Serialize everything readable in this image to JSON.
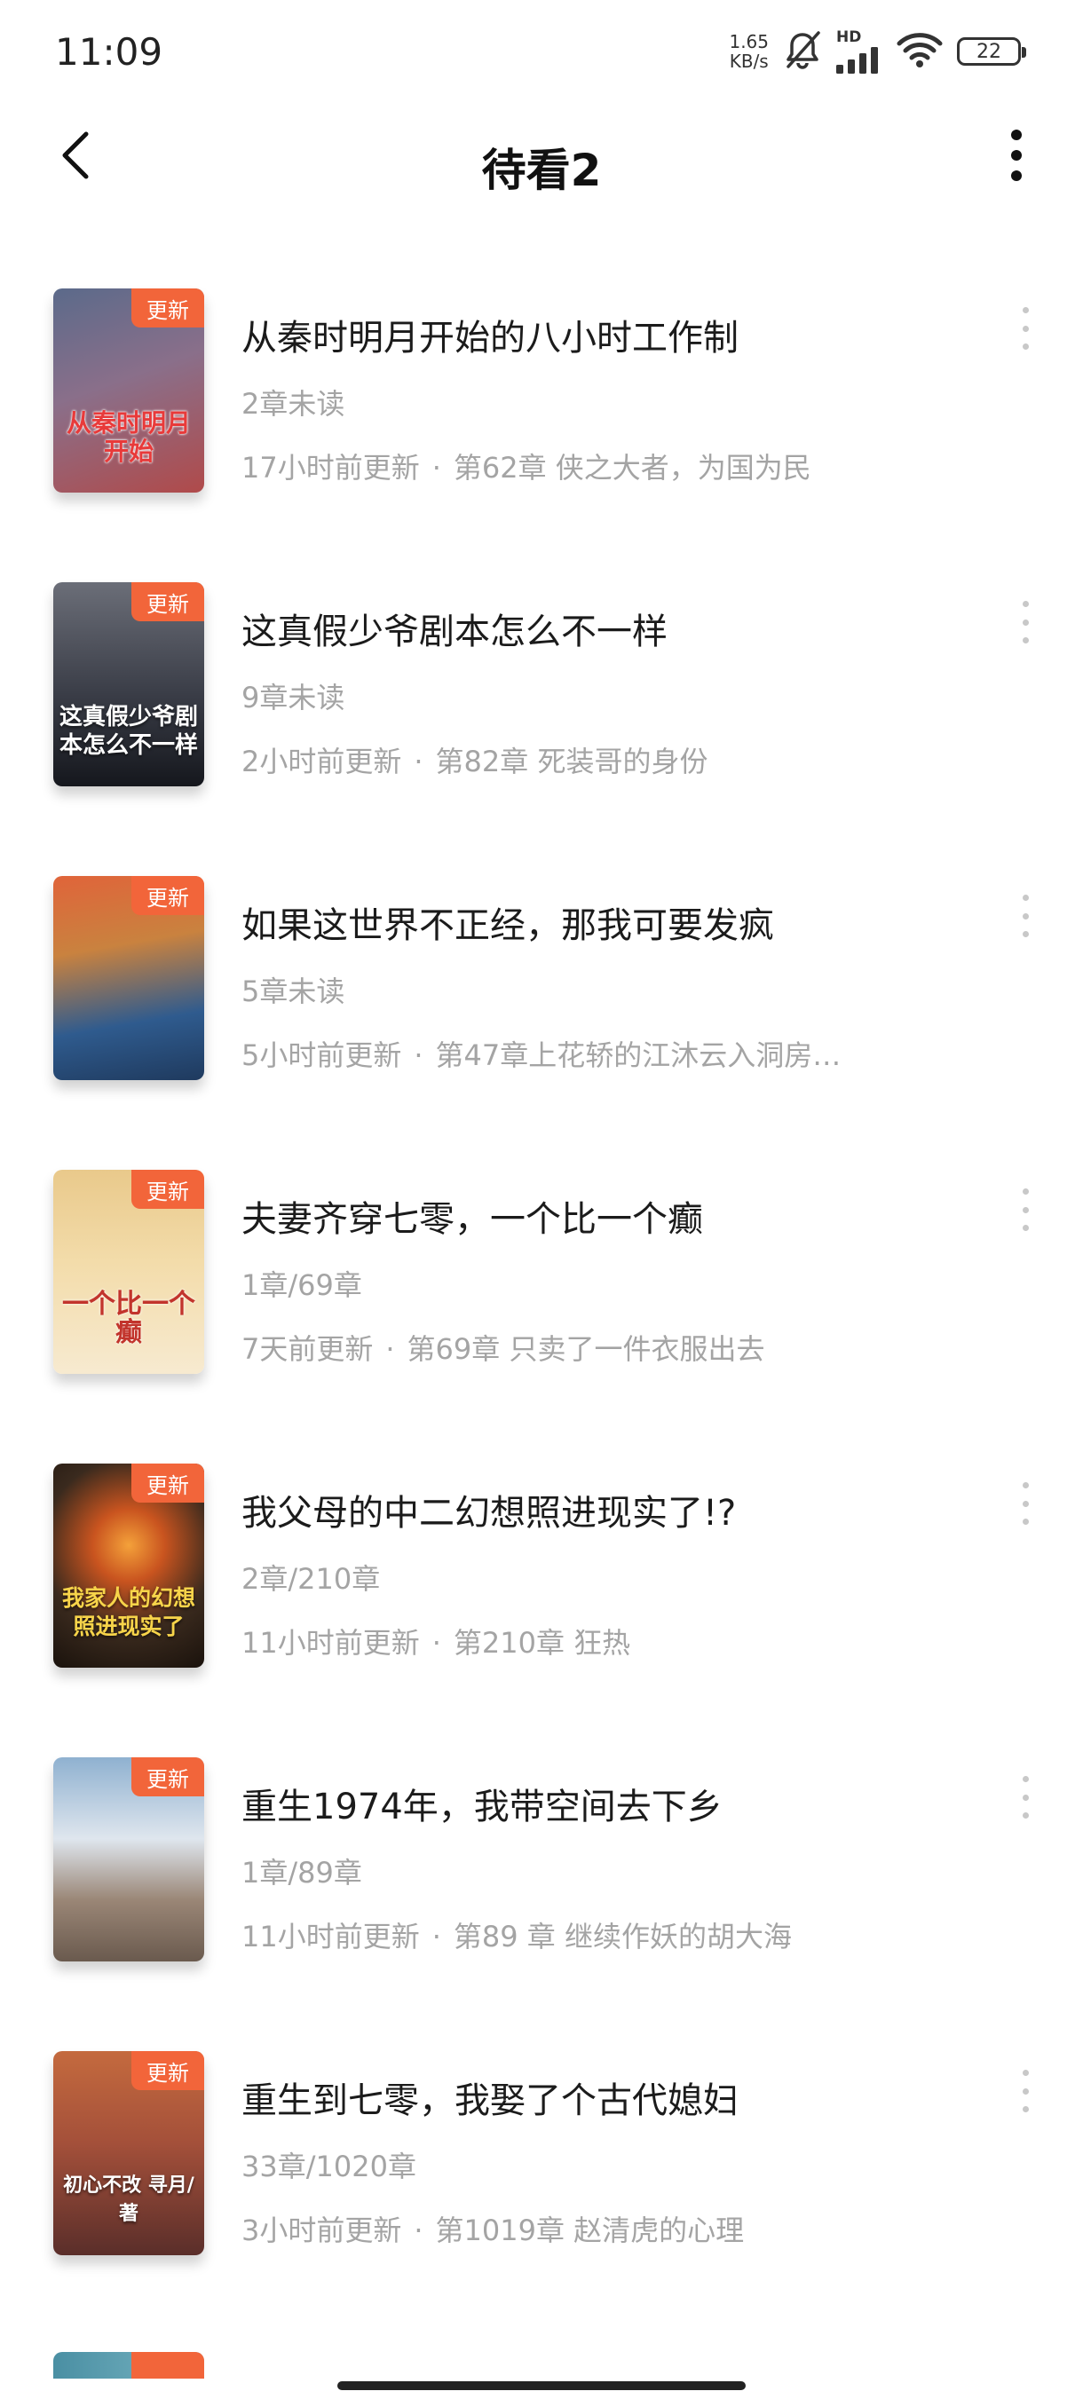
{
  "status_bar": {
    "time": "11:09",
    "net_speed_value": "1.65",
    "net_speed_unit": "KB/s",
    "network_label": "HD",
    "battery": "22"
  },
  "header": {
    "title": "待看2"
  },
  "books": [
    {
      "title": "从秦时明月开始的八小时工作制",
      "badge": "更新",
      "cover_text": "从秦时明月开始",
      "progress": "2章未读",
      "updated": "17小时前更新",
      "separator": "·",
      "latest": "第62章 侠之大者，为国为民",
      "cover_colors": [
        "#5b6a8a",
        "#b04a4a"
      ]
    },
    {
      "title": "这真假少爷剧本怎么不一样",
      "badge": "更新",
      "cover_text": "这真假少爷剧本怎么不一样",
      "progress": "9章未读",
      "updated": "2小时前更新",
      "separator": "·",
      "latest": "第82章 死装哥的身份",
      "cover_colors": [
        "#4a4d57",
        "#1d1f26"
      ]
    },
    {
      "title": "如果这世界不正经，那我可要发疯",
      "badge": "更新",
      "cover_text": "",
      "progress": "5章未读",
      "updated": "5小时前更新",
      "separator": "·",
      "latest": "第47章上花轿的江沐云入洞房…",
      "cover_colors": [
        "#e0643a",
        "#2f5b8e"
      ]
    },
    {
      "title": "夫妻齐穿七零，一个比一个癫",
      "badge": "更新",
      "cover_text": "一个比一个癫",
      "progress": "1章/69章",
      "updated": "7天前更新",
      "separator": "·",
      "latest": "第69章 只卖了一件衣服出去",
      "cover_colors": [
        "#e9c98b",
        "#f7ead0"
      ]
    },
    {
      "title": "我父母的中二幻想照进现实了!?",
      "badge": "更新",
      "cover_text": "我家人的幻想照进现实了",
      "progress": "2章/210章",
      "updated": "11小时前更新",
      "separator": "·",
      "latest": "第210章 狂热",
      "cover_colors": [
        "#3a2a1e",
        "#c9541f"
      ]
    },
    {
      "title": "重生1974年，我带空间去下乡",
      "badge": "更新",
      "cover_text": "",
      "progress": "1章/89章",
      "updated": "11小时前更新",
      "separator": "·",
      "latest": "第89 章 继续作妖的胡大海",
      "cover_colors": [
        "#8fb1d0",
        "#6a5a4e"
      ]
    },
    {
      "title": "重生到七零，我娶了个古代媳妇",
      "badge": "更新",
      "cover_text": "初心不改 寻月/著",
      "progress": "33章/1020章",
      "updated": "3小时前更新",
      "separator": "·",
      "latest": "第1019章 赵清虎的心理",
      "cover_colors": [
        "#c46a3e",
        "#5a2e2a"
      ]
    }
  ],
  "colors": {
    "badge": "#f2653a",
    "secondary_text": "#a4a4a4"
  }
}
